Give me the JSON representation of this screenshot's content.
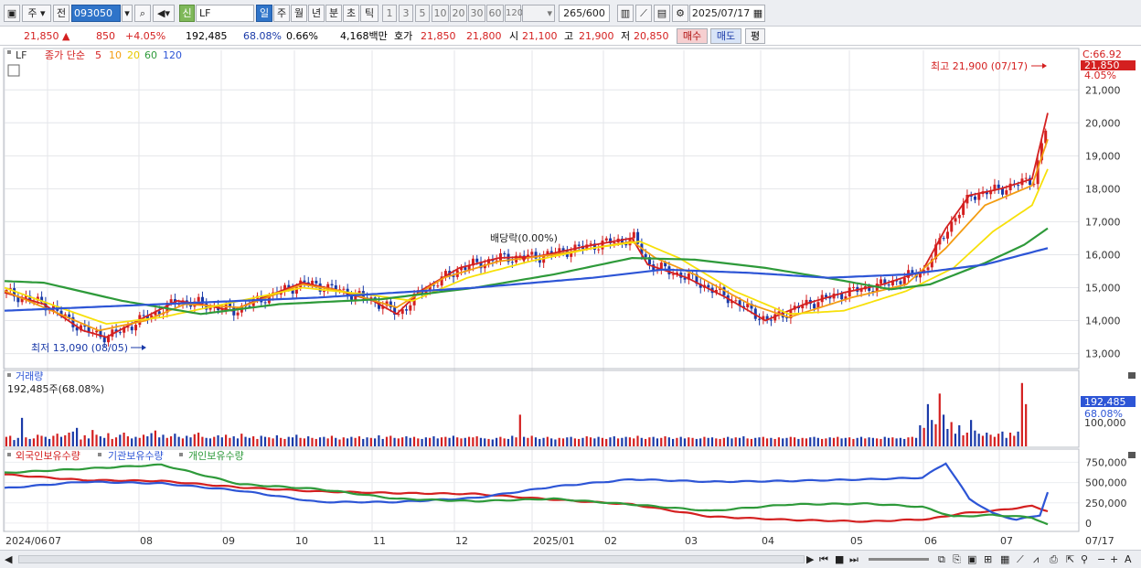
{
  "toolbar": {
    "market": "주",
    "prev": "전",
    "code": "093050",
    "badge": "신",
    "stock_name": "LF",
    "periods": [
      "일",
      "주",
      "월",
      "년",
      "분",
      "초",
      "틱"
    ],
    "active_period": "일",
    "intervals": [
      "1",
      "3",
      "5",
      "10",
      "20",
      "30",
      "60",
      "120"
    ],
    "count": "265",
    "count_total": "/600",
    "date": "2025/07/17"
  },
  "quote": {
    "price": "21,850",
    "arrow": "▲",
    "change": "850",
    "pct": "+4.05%",
    "volume": "192,485",
    "volume_ratio": "68.08%",
    "turnover": "0.66%",
    "amount": "4,168백만",
    "hoga_label": "호가",
    "ask": "21,850",
    "bid": "21,800",
    "open_label": "시",
    "open": "21,100",
    "high_label": "고",
    "high": "21,900",
    "low_label": "저",
    "low": "20,850",
    "buy": "매수",
    "sell": "매도",
    "eval": "평"
  },
  "price_panel": {
    "name": "LF",
    "ma_title": "종가 단순",
    "ma_periods": [
      "5",
      "10",
      "20",
      "60",
      "120"
    ],
    "ma_colors": [
      "#d42020",
      "#f39c12",
      "#f7e00a",
      "#2e9a3a",
      "#2d55d6"
    ],
    "high_note": "최고 21,900 (07/17)",
    "low_note": "최저 13,090 (08/05)",
    "dividend_note": "배당락(0.00%)",
    "corner_label": "C:66.92",
    "last_price_tag": "21,850",
    "last_pct_tag": "4.05%",
    "y_ticks": [
      "21,000",
      "20,000",
      "19,000",
      "18,000",
      "17,000",
      "16,000",
      "15,000",
      "14,000",
      "13,000"
    ]
  },
  "volume_panel": {
    "title": "거래량",
    "subtitle": "192,485주(68.08%)",
    "tag_value": "192,485",
    "tag_pct": "68.08%",
    "y_ticks": [
      "100,000"
    ]
  },
  "holding_panel": {
    "series_names": [
      "외국인보유수량",
      "기관보유수량",
      "개인보유수량"
    ],
    "series_colors": [
      "#d42020",
      "#2d55d6",
      "#2e9a3a"
    ],
    "y_ticks": [
      "750,000",
      "500,000",
      "250,000",
      "0"
    ]
  },
  "x_axis": {
    "labels": [
      "2024/06",
      "07",
      "08",
      "09",
      "10",
      "11",
      "12",
      "2025/01",
      "02",
      "03",
      "04",
      "05",
      "06",
      "07"
    ],
    "last_label": "07/17"
  },
  "chart_data": {
    "type": "line",
    "title": "",
    "ylabel": "",
    "ylim": [
      12600,
      22200
    ],
    "series": [
      {
        "name": "5",
        "points": [
          [
            0,
            14850
          ],
          [
            10,
            14500
          ],
          [
            20,
            13700
          ],
          [
            26,
            13500
          ],
          [
            34,
            14000
          ],
          [
            44,
            14600
          ],
          [
            50,
            14500
          ],
          [
            58,
            14300
          ],
          [
            66,
            14700
          ],
          [
            76,
            15150
          ],
          [
            84,
            14950
          ],
          [
            94,
            14600
          ],
          [
            100,
            14200
          ],
          [
            106,
            14900
          ],
          [
            116,
            15600
          ],
          [
            126,
            15900
          ],
          [
            136,
            15950
          ],
          [
            148,
            16250
          ],
          [
            160,
            16500
          ],
          [
            164,
            15700
          ],
          [
            174,
            15300
          ],
          [
            184,
            14700
          ],
          [
            194,
            14000
          ],
          [
            204,
            14500
          ],
          [
            214,
            14850
          ],
          [
            224,
            15100
          ],
          [
            234,
            15500
          ],
          [
            240,
            16800
          ],
          [
            246,
            17800
          ],
          [
            254,
            18000
          ],
          [
            262,
            18300
          ],
          [
            266,
            20300
          ]
        ]
      },
      {
        "name": "10",
        "points": [
          [
            0,
            14900
          ],
          [
            12,
            14300
          ],
          [
            24,
            13700
          ],
          [
            36,
            14000
          ],
          [
            46,
            14500
          ],
          [
            60,
            14400
          ],
          [
            76,
            15100
          ],
          [
            86,
            14900
          ],
          [
            100,
            14400
          ],
          [
            112,
            15300
          ],
          [
            126,
            15800
          ],
          [
            140,
            16000
          ],
          [
            160,
            16400
          ],
          [
            166,
            15900
          ],
          [
            176,
            15400
          ],
          [
            190,
            14500
          ],
          [
            200,
            14100
          ],
          [
            216,
            14700
          ],
          [
            230,
            15100
          ],
          [
            240,
            16200
          ],
          [
            250,
            17500
          ],
          [
            262,
            18100
          ],
          [
            266,
            19500
          ]
        ]
      },
      {
        "name": "20",
        "points": [
          [
            0,
            15000
          ],
          [
            14,
            14400
          ],
          [
            26,
            13900
          ],
          [
            40,
            14100
          ],
          [
            56,
            14500
          ],
          [
            76,
            15000
          ],
          [
            92,
            14800
          ],
          [
            104,
            14600
          ],
          [
            118,
            15300
          ],
          [
            134,
            15800
          ],
          [
            150,
            16200
          ],
          [
            162,
            16400
          ],
          [
            172,
            15900
          ],
          [
            186,
            14900
          ],
          [
            200,
            14200
          ],
          [
            214,
            14300
          ],
          [
            230,
            14900
          ],
          [
            242,
            15600
          ],
          [
            252,
            16700
          ],
          [
            262,
            17500
          ],
          [
            266,
            18600
          ]
        ]
      },
      {
        "name": "60",
        "points": [
          [
            0,
            15200
          ],
          [
            10,
            15150
          ],
          [
            30,
            14600
          ],
          [
            50,
            14200
          ],
          [
            70,
            14500
          ],
          [
            96,
            14650
          ],
          [
            120,
            15000
          ],
          [
            140,
            15400
          ],
          [
            160,
            15900
          ],
          [
            176,
            15850
          ],
          [
            194,
            15600
          ],
          [
            212,
            15250
          ],
          [
            226,
            14950
          ],
          [
            236,
            15100
          ],
          [
            250,
            15750
          ],
          [
            260,
            16300
          ],
          [
            266,
            16800
          ]
        ]
      },
      {
        "name": "120",
        "points": [
          [
            0,
            14300
          ],
          [
            40,
            14500
          ],
          [
            80,
            14700
          ],
          [
            120,
            15000
          ],
          [
            150,
            15300
          ],
          [
            168,
            15550
          ],
          [
            190,
            15450
          ],
          [
            210,
            15300
          ],
          [
            230,
            15400
          ],
          [
            250,
            15700
          ],
          [
            266,
            16200
          ]
        ]
      }
    ],
    "volume_series": [
      {
        "name": "거래량",
        "values": [
          18,
          20,
          12,
          16,
          54,
          17,
          14,
          15,
          22,
          20,
          18,
          14,
          20,
          24,
          18,
          21,
          26,
          28,
          35,
          13,
          21,
          15,
          31,
          22,
          19,
          16,
          25,
          14,
          17,
          22,
          26,
          19,
          15,
          18,
          16,
          22,
          19,
          25,
          30,
          17,
          22,
          16,
          19,
          24,
          18,
          15,
          20,
          17,
          23,
          26,
          18,
          16,
          15,
          18,
          21,
          17,
          22,
          16,
          19,
          15,
          24,
          18,
          16,
          19,
          14,
          20,
          18,
          17,
          15,
          21,
          16,
          14,
          18,
          17,
          22,
          16,
          15,
          19,
          16,
          14,
          17,
          18,
          15,
          20,
          16,
          13,
          17,
          15,
          18,
          16,
          19,
          14,
          17,
          16,
          15,
          21,
          14,
          18,
          20,
          16,
          15,
          17,
          19,
          16,
          18,
          15,
          14,
          17,
          16,
          19,
          15,
          17,
          18,
          16,
          20,
          17,
          15,
          16,
          18,
          17,
          19,
          16,
          15,
          14,
          13,
          16,
          18,
          15,
          14,
          20,
          17,
          60,
          18,
          16,
          20,
          17,
          14,
          16,
          18,
          15,
          13,
          16,
          15,
          17,
          18,
          15,
          14,
          16,
          19,
          17,
          15,
          18,
          16,
          14,
          17,
          19,
          15,
          16,
          18,
          17,
          15,
          20,
          16,
          14,
          17,
          18,
          15,
          16,
          19,
          17,
          14,
          16,
          18,
          15,
          17,
          16,
          14,
          15,
          18,
          16,
          17,
          15,
          14,
          16,
          18,
          15,
          17,
          16,
          19,
          15,
          14,
          16,
          17,
          18,
          15,
          16,
          14,
          17,
          15,
          16,
          18,
          17,
          14,
          16,
          15,
          17,
          18,
          16,
          14,
          15,
          17,
          16,
          18,
          15,
          16,
          17,
          14,
          16,
          18,
          15,
          17,
          16,
          15,
          14,
          18,
          16,
          17,
          15,
          16,
          14,
          17,
          18,
          16,
          40,
          35,
          80,
          50,
          42,
          100,
          60,
          33,
          46,
          24,
          40,
          21,
          26,
          50,
          30,
          24,
          20,
          26,
          22,
          18,
          24,
          28,
          16,
          26,
          20,
          28,
          120,
          80
        ]
      }
    ],
    "holding_series": [
      {
        "name": "외국인보유수량",
        "points": [
          [
            0,
            600000
          ],
          [
            20,
            530000
          ],
          [
            40,
            520000
          ],
          [
            60,
            440000
          ],
          [
            80,
            390000
          ],
          [
            100,
            370000
          ],
          [
            120,
            360000
          ],
          [
            140,
            290000
          ],
          [
            160,
            230000
          ],
          [
            180,
            80000
          ],
          [
            200,
            40000
          ],
          [
            220,
            20000
          ],
          [
            236,
            50000
          ],
          [
            244,
            120000
          ],
          [
            252,
            150000
          ],
          [
            262,
            210000
          ],
          [
            266,
            150000
          ]
        ]
      },
      {
        "name": "기관보유수량",
        "points": [
          [
            0,
            430000
          ],
          [
            20,
            510000
          ],
          [
            40,
            490000
          ],
          [
            60,
            400000
          ],
          [
            80,
            260000
          ],
          [
            100,
            260000
          ],
          [
            120,
            310000
          ],
          [
            140,
            450000
          ],
          [
            160,
            540000
          ],
          [
            180,
            510000
          ],
          [
            200,
            520000
          ],
          [
            220,
            540000
          ],
          [
            234,
            560000
          ],
          [
            240,
            740000
          ],
          [
            246,
            300000
          ],
          [
            252,
            120000
          ],
          [
            258,
            40000
          ],
          [
            264,
            100000
          ],
          [
            266,
            380000
          ]
        ]
      },
      {
        "name": "개인보유수량",
        "points": [
          [
            0,
            620000
          ],
          [
            20,
            670000
          ],
          [
            40,
            720000
          ],
          [
            60,
            480000
          ],
          [
            80,
            420000
          ],
          [
            100,
            300000
          ],
          [
            120,
            270000
          ],
          [
            140,
            300000
          ],
          [
            160,
            230000
          ],
          [
            180,
            150000
          ],
          [
            200,
            230000
          ],
          [
            220,
            240000
          ],
          [
            234,
            200000
          ],
          [
            242,
            80000
          ],
          [
            252,
            100000
          ],
          [
            262,
            70000
          ],
          [
            266,
            -20000
          ]
        ]
      }
    ]
  }
}
